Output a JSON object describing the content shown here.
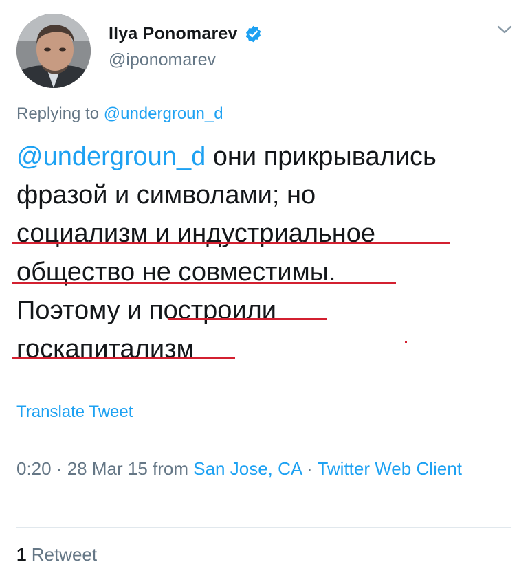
{
  "author": {
    "name": "Ilya Ponomarev",
    "handle": "@iponomarev",
    "verified": true,
    "avatar_icon": "user-avatar-photo"
  },
  "reply": {
    "prefix": "Replying to",
    "target": "@undergroun_d"
  },
  "tweet": {
    "mention": "@undergroun_d",
    "line1_rest": " они прикрывались",
    "line2": "фразой и символами; но",
    "line3": "социализм и индустриальное",
    "line4": "общество не совместимы.",
    "line5_a": "Поэтому и ",
    "line5_b": "построили",
    "line6": "госкапитализм"
  },
  "translate_label": "Translate Tweet",
  "meta": {
    "time": "0:20",
    "sep1": " · ",
    "date": "28 Mar 15",
    "from_word": " from ",
    "location": "San Jose, CA",
    "sep2": " · ",
    "client": "Twitter Web Client"
  },
  "stats": {
    "retweet_count": "1",
    "retweet_label": "Retweet"
  },
  "colors": {
    "link": "#1da1f2",
    "secondary": "#657786",
    "text": "#14171a",
    "underline": "#d32030"
  },
  "icons": {
    "verified": "verified-badge-icon",
    "chevron": "chevron-down-icon"
  }
}
